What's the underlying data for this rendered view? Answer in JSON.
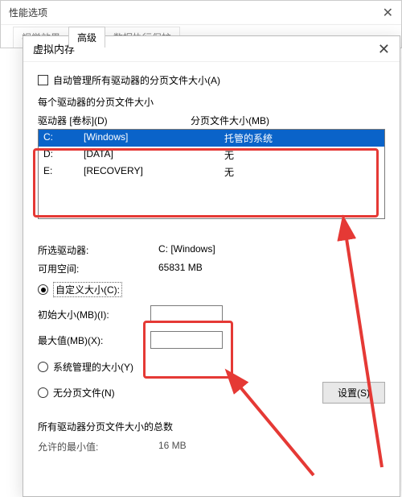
{
  "outer": {
    "title": "性能选项",
    "close_glyph": "✕",
    "tabs": {
      "visual": "视觉效果",
      "advanced": "高级",
      "dep": "数据执行保护"
    }
  },
  "inner": {
    "title": "虚拟内存",
    "close_glyph": "✕",
    "auto_manage": "自动管理所有驱动器的分页文件大小(A)",
    "per_drive_label": "每个驱动器的分页文件大小",
    "header_drive": "驱动器 [卷标](D)",
    "header_paging": "分页文件大小(MB)",
    "drives": [
      {
        "letter": "C:",
        "vol": "[Windows]",
        "status": "托管的系统",
        "selected": true
      },
      {
        "letter": "D:",
        "vol": "[DATA]",
        "status": "无",
        "selected": false
      },
      {
        "letter": "E:",
        "vol": "[RECOVERY]",
        "status": "无",
        "selected": false
      }
    ],
    "selected_drive_label": "所选驱动器:",
    "selected_drive_value": "C:  [Windows]",
    "free_space_label": "可用空间:",
    "free_space_value": "65831 MB",
    "radio_custom": "自定义大小(C):",
    "initial_label": "初始大小(MB)(I):",
    "max_label": "最大值(MB)(X):",
    "radio_system": "系统管理的大小(Y)",
    "radio_none": "无分页文件(N)",
    "set_button": "设置(S)",
    "totals_label": "所有驱动器分页文件大小的总数",
    "allowed_min_label": "允许的最小值:",
    "allowed_min_value": "16 MB"
  }
}
